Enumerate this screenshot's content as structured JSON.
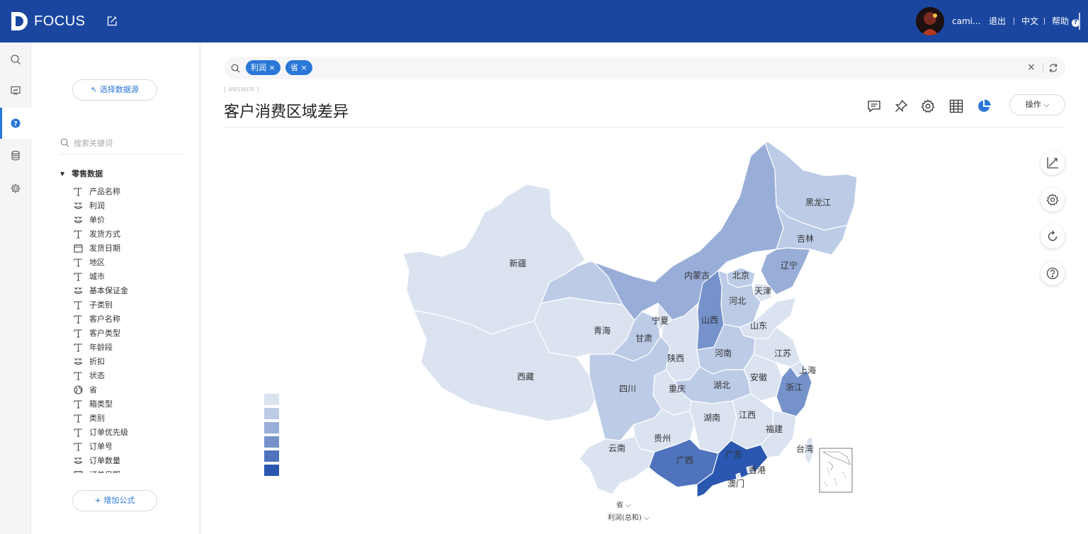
{
  "app": {
    "logo_text": "FOCUS"
  },
  "header": {
    "username": "cami...",
    "logout": "退出",
    "language": "中文",
    "help": "帮助",
    "help_mark": "?"
  },
  "rail": {
    "items": [
      {
        "icon": "search-icon"
      },
      {
        "icon": "board-icon"
      },
      {
        "icon": "question-icon",
        "active": true
      },
      {
        "icon": "database-icon"
      },
      {
        "icon": "gear-icon"
      }
    ]
  },
  "panel": {
    "select_source": "↖ 选择数据源",
    "search_placeholder": "搜索关键词",
    "root_label": "零售数据",
    "add_formula": "+ 增加公式",
    "fields": [
      {
        "label": "产品名称",
        "type": "text"
      },
      {
        "label": "利润",
        "type": "measure"
      },
      {
        "label": "单价",
        "type": "measure"
      },
      {
        "label": "发货方式",
        "type": "text"
      },
      {
        "label": "发货日期",
        "type": "date"
      },
      {
        "label": "地区",
        "type": "text"
      },
      {
        "label": "城市",
        "type": "text"
      },
      {
        "label": "基本保证金",
        "type": "measure"
      },
      {
        "label": "子类别",
        "type": "text"
      },
      {
        "label": "客户名称",
        "type": "text"
      },
      {
        "label": "客户类型",
        "type": "text"
      },
      {
        "label": "年龄段",
        "type": "text"
      },
      {
        "label": "折扣",
        "type": "measure"
      },
      {
        "label": "状态",
        "type": "text"
      },
      {
        "label": "省",
        "type": "geo"
      },
      {
        "label": "箱类型",
        "type": "text"
      },
      {
        "label": "类别",
        "type": "text"
      },
      {
        "label": "订单优先级",
        "type": "text"
      },
      {
        "label": "订单号",
        "type": "text"
      },
      {
        "label": "订单数量",
        "type": "measure"
      },
      {
        "label": "订单日期",
        "type": "date"
      }
    ]
  },
  "search": {
    "tokens": [
      "利润",
      "省"
    ],
    "clear_symbol": "×"
  },
  "answer": {
    "tag": "[ ANSWER ]",
    "title": "客户消费区域差异",
    "operations": "操作",
    "x_axis": "省",
    "y_axis": "利润(总和)"
  },
  "colors": {
    "topbar": "#1a46a0",
    "accent": "#2a77d8",
    "scale": [
      "#dbe3f1",
      "#bccbe6",
      "#98aed8",
      "#7592cb",
      "#4f74bd",
      "#2a57b0"
    ]
  },
  "map": {
    "regions": [
      {
        "name": "新疆",
        "level": 0
      },
      {
        "name": "西藏",
        "level": 0
      },
      {
        "name": "青海",
        "level": 0
      },
      {
        "name": "甘肃",
        "level": 1
      },
      {
        "name": "宁夏",
        "level": 0
      },
      {
        "name": "内蒙古",
        "level": 2
      },
      {
        "name": "黑龙江",
        "level": 1
      },
      {
        "name": "吉林",
        "level": 1
      },
      {
        "name": "辽宁",
        "level": 2
      },
      {
        "name": "北京",
        "level": 1
      },
      {
        "name": "天津",
        "level": 0
      },
      {
        "name": "河北",
        "level": 1
      },
      {
        "name": "山西",
        "level": 3
      },
      {
        "name": "山东",
        "level": 0
      },
      {
        "name": "河南",
        "level": 1
      },
      {
        "name": "陕西",
        "level": 0
      },
      {
        "name": "江苏",
        "level": 0
      },
      {
        "name": "上海",
        "level": 0
      },
      {
        "name": "安徽",
        "level": 0
      },
      {
        "name": "浙江",
        "level": 3
      },
      {
        "name": "湖北",
        "level": 1
      },
      {
        "name": "重庆",
        "level": 0
      },
      {
        "name": "四川",
        "level": 1
      },
      {
        "name": "贵州",
        "level": 0
      },
      {
        "name": "湖南",
        "level": 0
      },
      {
        "name": "江西",
        "level": 0
      },
      {
        "name": "福建",
        "level": 0
      },
      {
        "name": "云南",
        "level": 0
      },
      {
        "name": "广西",
        "level": 4
      },
      {
        "name": "广东",
        "level": 5
      },
      {
        "name": "香港",
        "level": 0
      },
      {
        "name": "澳门",
        "level": 0
      },
      {
        "name": "台湾",
        "level": 0
      }
    ]
  }
}
